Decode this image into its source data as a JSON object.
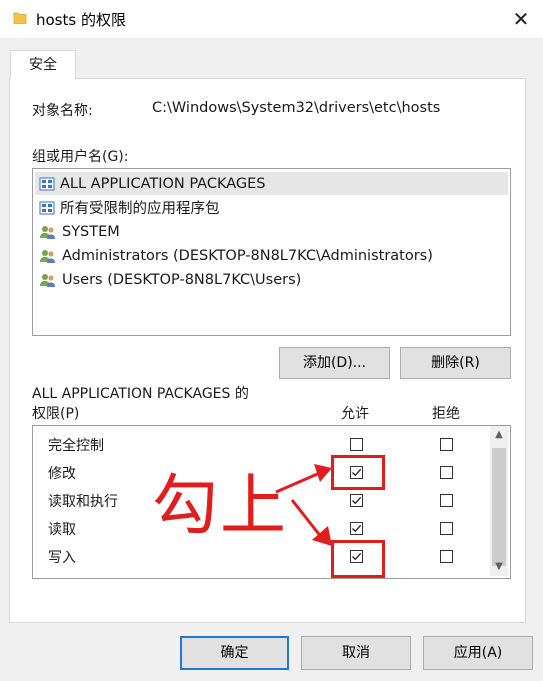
{
  "window": {
    "title": "hosts 的权限",
    "close_glyph": "✕"
  },
  "tabs": [
    {
      "label": "安全"
    }
  ],
  "object": {
    "label": "对象名称:",
    "value": "C:\\Windows\\System32\\drivers\\etc\\hosts"
  },
  "groups": {
    "label": "组或用户名(G):",
    "items": [
      {
        "name": "ALL APPLICATION PACKAGES",
        "icon": "app-packages-icon",
        "selected": true
      },
      {
        "name": "所有受限制的应用程序包",
        "icon": "app-packages-icon",
        "selected": false
      },
      {
        "name": "SYSTEM",
        "icon": "users-icon",
        "selected": false
      },
      {
        "name": "Administrators (DESKTOP-8N8L7KC\\Administrators)",
        "icon": "users-icon",
        "selected": false
      },
      {
        "name": "Users (DESKTOP-8N8L7KC\\Users)",
        "icon": "users-icon",
        "selected": false
      }
    ],
    "add_button": "添加(D)...",
    "remove_button": "删除(R)"
  },
  "permissions": {
    "title_line1": "ALL APPLICATION PACKAGES 的",
    "title_line2": "权限(P)",
    "allow_header": "允许",
    "deny_header": "拒绝",
    "rows": [
      {
        "label": "完全控制",
        "allow": false,
        "deny": false
      },
      {
        "label": "修改",
        "allow": true,
        "deny": false
      },
      {
        "label": "读取和执行",
        "allow": true,
        "deny": false
      },
      {
        "label": "读取",
        "allow": true,
        "deny": false
      },
      {
        "label": "写入",
        "allow": true,
        "deny": false
      }
    ]
  },
  "annotation": {
    "text": "勾上",
    "color": "#e11d1d"
  },
  "footer": {
    "ok": "确定",
    "cancel": "取消",
    "apply": "应用(A)"
  },
  "colors": {
    "accent": "#1a7bd6",
    "selection": "#e6e6e6",
    "annotation": "#e11d1d",
    "folder": "#f5c542"
  }
}
